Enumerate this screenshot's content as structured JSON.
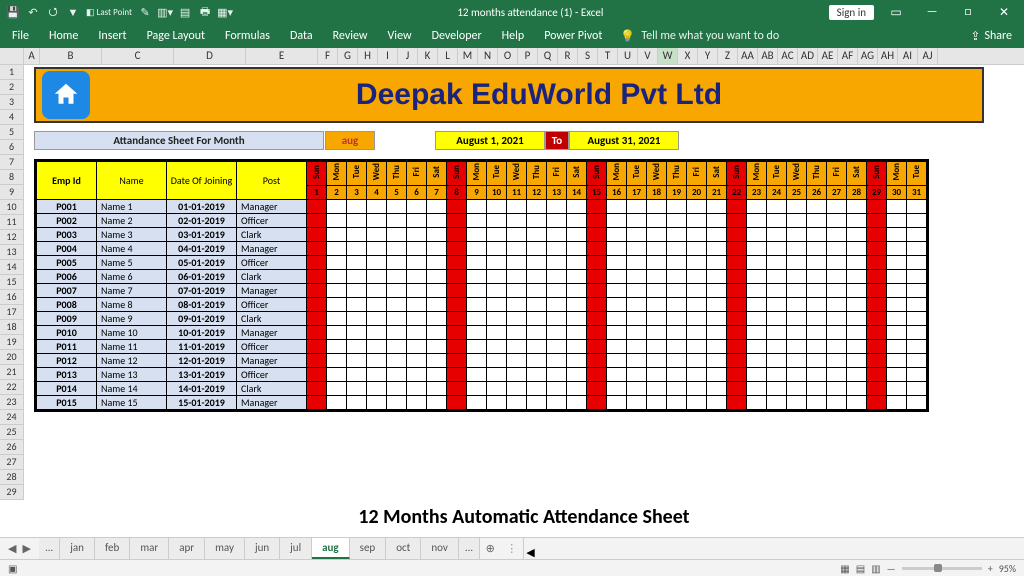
{
  "titlebar": {
    "title": "12 months attendance (1)  -  Excel",
    "signin": "Sign in"
  },
  "ribbon": {
    "tabs": [
      "File",
      "Home",
      "Insert",
      "Page Layout",
      "Formulas",
      "Data",
      "Review",
      "View",
      "Developer",
      "Help",
      "Power Pivot"
    ],
    "tell": "Tell me what you want to do",
    "share": "Share"
  },
  "columns": [
    "A",
    "B",
    "C",
    "D",
    "E",
    "F",
    "G",
    "H",
    "I",
    "J",
    "K",
    "L",
    "M",
    "N",
    "O",
    "P",
    "Q",
    "R",
    "S",
    "T",
    "U",
    "V",
    "W",
    "X",
    "Y",
    "Z",
    "AA",
    "AB",
    "AC",
    "AD",
    "AE",
    "AF",
    "AG",
    "AH",
    "AI",
    "AJ"
  ],
  "sel_col": "W",
  "rows_start": 1,
  "rows_end": 29,
  "company": "Deepak EduWorld Pvt Ltd",
  "month": {
    "label": "Attandance Sheet For Month",
    "value": "aug",
    "from": "August 1, 2021",
    "to_label": "To",
    "to": "August 31, 2021"
  },
  "headers": {
    "emp": "Emp Id",
    "name": "Name",
    "doj": "Date Of Joining",
    "post": "Post"
  },
  "days": [
    {
      "d": "Sun",
      "n": 1,
      "s": true
    },
    {
      "d": "Mon",
      "n": 2
    },
    {
      "d": "Tue",
      "n": 3
    },
    {
      "d": "Wed",
      "n": 4
    },
    {
      "d": "Thu",
      "n": 5
    },
    {
      "d": "Fri",
      "n": 6
    },
    {
      "d": "Sat",
      "n": 7
    },
    {
      "d": "Sun",
      "n": 8,
      "s": true
    },
    {
      "d": "Mon",
      "n": 9
    },
    {
      "d": "Tue",
      "n": 10
    },
    {
      "d": "Wed",
      "n": 11
    },
    {
      "d": "Thu",
      "n": 12
    },
    {
      "d": "Fri",
      "n": 13
    },
    {
      "d": "Sat",
      "n": 14
    },
    {
      "d": "Sun",
      "n": 15,
      "s": true
    },
    {
      "d": "Mon",
      "n": 16
    },
    {
      "d": "Tue",
      "n": 17
    },
    {
      "d": "Wed",
      "n": 18
    },
    {
      "d": "Thu",
      "n": 19
    },
    {
      "d": "Fri",
      "n": 20
    },
    {
      "d": "Sat",
      "n": 21
    },
    {
      "d": "Sun",
      "n": 22,
      "s": true
    },
    {
      "d": "Mon",
      "n": 23
    },
    {
      "d": "Tue",
      "n": 24
    },
    {
      "d": "Wed",
      "n": 25
    },
    {
      "d": "Thu",
      "n": 26
    },
    {
      "d": "Fri",
      "n": 27
    },
    {
      "d": "Sat",
      "n": 28
    },
    {
      "d": "Sun",
      "n": 29,
      "s": true
    },
    {
      "d": "Mon",
      "n": 30
    },
    {
      "d": "Tue",
      "n": 31
    }
  ],
  "employees": [
    {
      "id": "P001",
      "name": "Name 1",
      "doj": "01-01-2019",
      "post": "Manager"
    },
    {
      "id": "P002",
      "name": "Name 2",
      "doj": "02-01-2019",
      "post": "Officer"
    },
    {
      "id": "P003",
      "name": "Name 3",
      "doj": "03-01-2019",
      "post": "Clark"
    },
    {
      "id": "P004",
      "name": "Name 4",
      "doj": "04-01-2019",
      "post": "Manager"
    },
    {
      "id": "P005",
      "name": "Name 5",
      "doj": "05-01-2019",
      "post": "Officer"
    },
    {
      "id": "P006",
      "name": "Name 6",
      "doj": "06-01-2019",
      "post": "Clark"
    },
    {
      "id": "P007",
      "name": "Name 7",
      "doj": "07-01-2019",
      "post": "Manager"
    },
    {
      "id": "P008",
      "name": "Name 8",
      "doj": "08-01-2019",
      "post": "Officer"
    },
    {
      "id": "P009",
      "name": "Name 9",
      "doj": "09-01-2019",
      "post": "Clark"
    },
    {
      "id": "P010",
      "name": "Name 10",
      "doj": "10-01-2019",
      "post": "Manager"
    },
    {
      "id": "P011",
      "name": "Name 11",
      "doj": "11-01-2019",
      "post": "Officer"
    },
    {
      "id": "P012",
      "name": "Name 12",
      "doj": "12-01-2019",
      "post": "Manager"
    },
    {
      "id": "P013",
      "name": "Name 13",
      "doj": "13-01-2019",
      "post": "Officer"
    },
    {
      "id": "P014",
      "name": "Name 14",
      "doj": "14-01-2019",
      "post": "Clark"
    },
    {
      "id": "P015",
      "name": "Name 15",
      "doj": "15-01-2019",
      "post": "Manager"
    }
  ],
  "caption": "12 Months Automatic Attendance Sheet",
  "sheet_tabs": [
    "...",
    "jan",
    "feb",
    "mar",
    "apr",
    "may",
    "jun",
    "jul",
    "aug",
    "sep",
    "oct",
    "nov",
    "..."
  ],
  "active_tab": "aug",
  "status": {
    "zoom": "95%"
  }
}
